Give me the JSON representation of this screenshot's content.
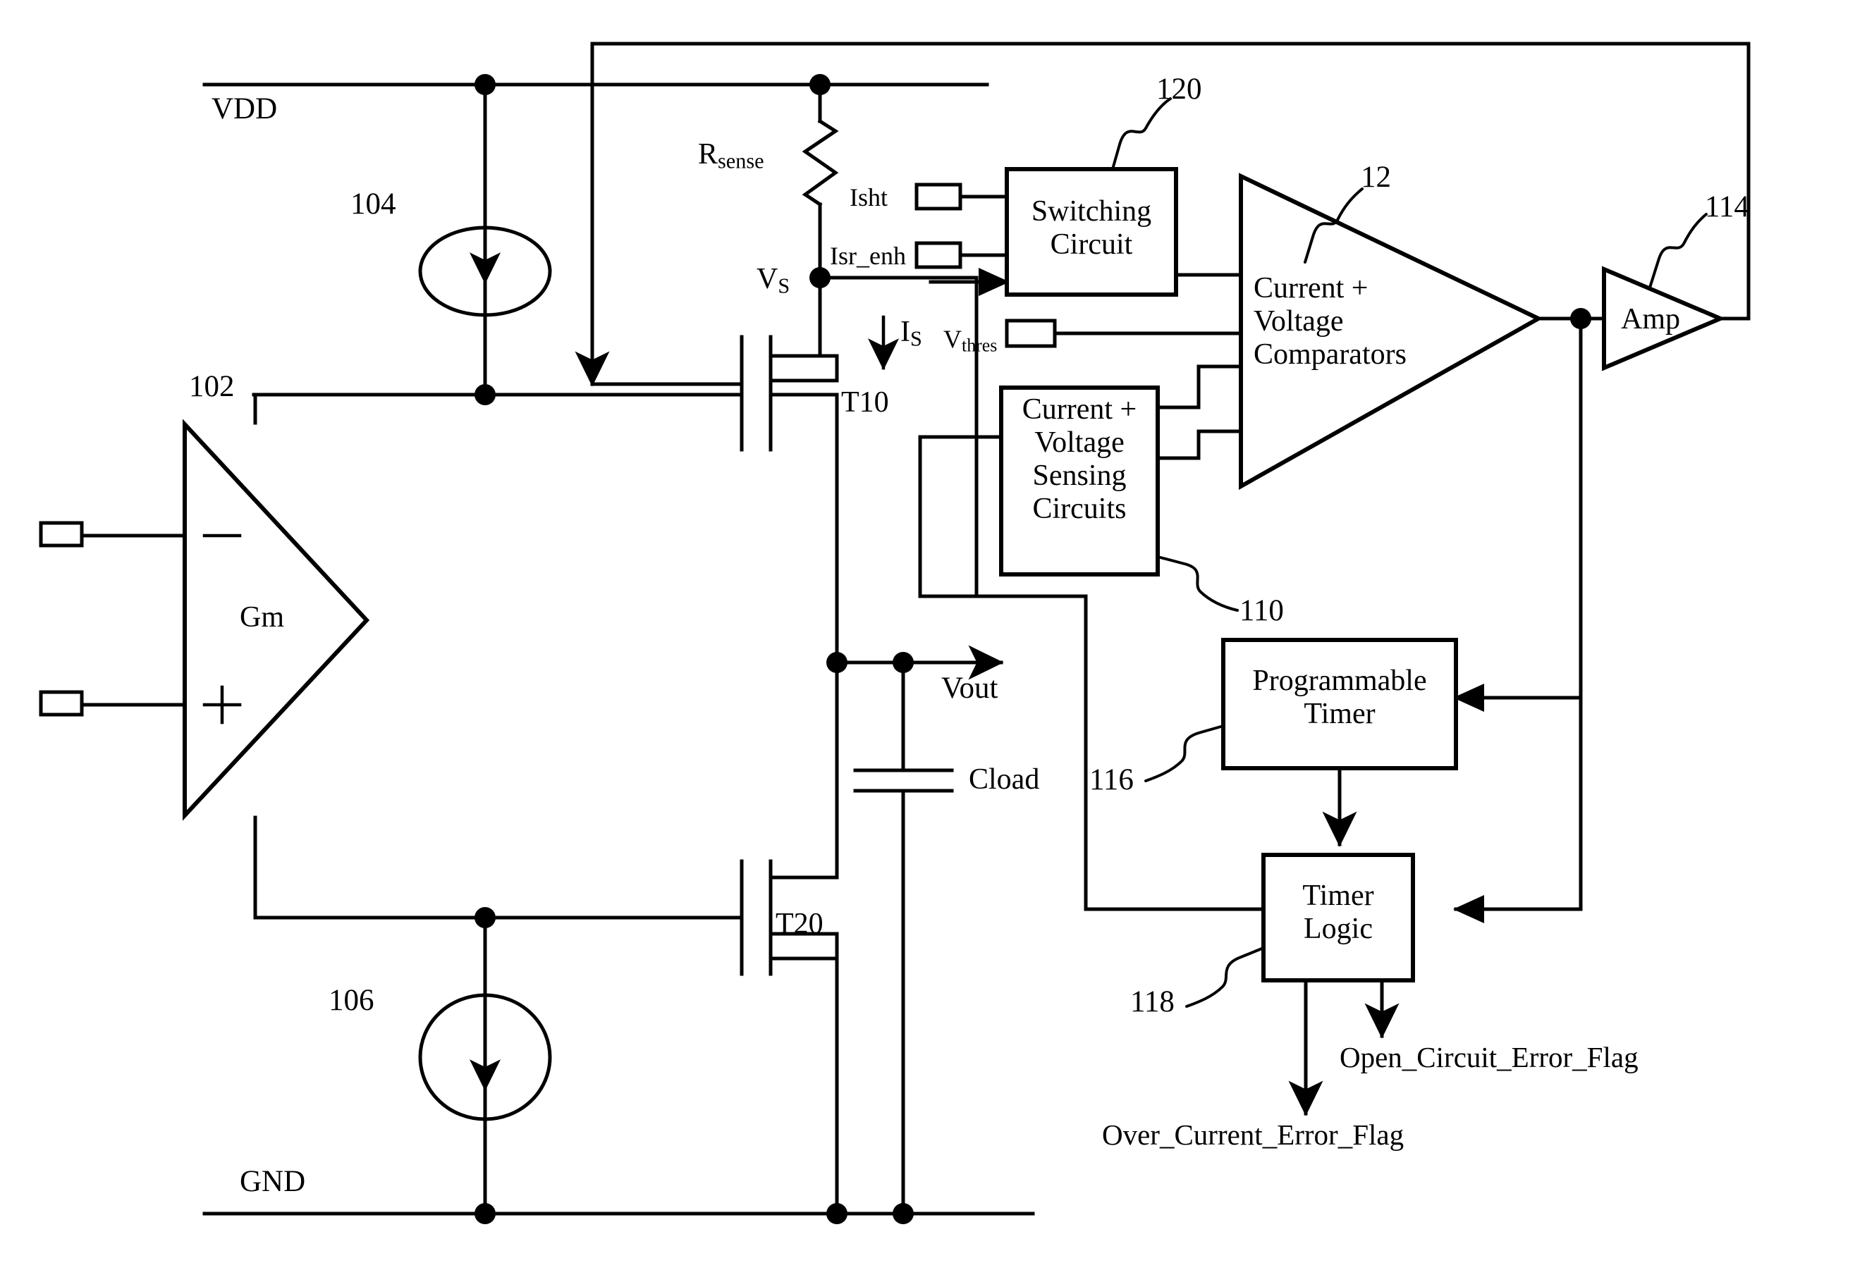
{
  "figure": {
    "type": "electronic-schematic",
    "description": "Voltage regulator with current/voltage sensing, comparators and timer-based error flag logic"
  },
  "nets": {
    "vdd": "VDD",
    "gnd": "GND",
    "vs": "V",
    "vs_sub": "S",
    "vout": "Vout",
    "is": "I",
    "is_sub": "S"
  },
  "reference_numerals": {
    "gm_amp": "102",
    "current_source_top": "104",
    "current_source_bottom": "106",
    "sensing_circuits": "110",
    "comparators": "12",
    "output_amp": "114",
    "programmable_timer": "116",
    "timer_logic": "118",
    "switching_circuit": "120"
  },
  "components": {
    "gm": {
      "label": "Gm",
      "minus": "−",
      "plus": "+"
    },
    "rsense": {
      "label": "R",
      "label_sub": "sense"
    },
    "t10": {
      "label": "T10"
    },
    "t20": {
      "label": "T20"
    },
    "cload": {
      "label": "Cload"
    },
    "amp": {
      "label": "Amp"
    }
  },
  "blocks": [
    {
      "name": "switching-circuit",
      "line1": "Switching",
      "line2": "Circuit"
    },
    {
      "name": "comparators",
      "line1": "Current +",
      "line2": "Voltage",
      "line3": "Comparators"
    },
    {
      "name": "sensing-circuits",
      "line1": "Current +",
      "line2": "Voltage",
      "line3": "Sensing",
      "line4": "Circuits"
    },
    {
      "name": "programmable-timer",
      "line1": "Programmable",
      "line2": "Timer"
    },
    {
      "name": "timer-logic",
      "line1": "Timer",
      "line2": "Logic"
    }
  ],
  "pins": {
    "isht": "Isht",
    "isr_enh": "Isr_enh",
    "vthres": "V",
    "vthres_sub": "thres"
  },
  "outputs": {
    "open_circuit": "Open_Circuit_Error_Flag",
    "over_current": "Over_Current_Error_Flag"
  },
  "colors": {
    "ink": "#000000",
    "paper": "#ffffff"
  }
}
